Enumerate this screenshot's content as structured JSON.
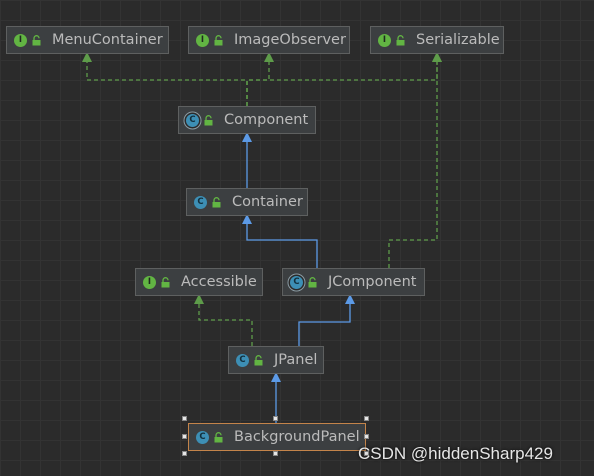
{
  "diagram": {
    "nodes": [
      {
        "id": "menucontainer",
        "label": "MenuContainer",
        "kind": "interface",
        "badge": "I"
      },
      {
        "id": "imageobserver",
        "label": "ImageObserver",
        "kind": "interface",
        "badge": "I"
      },
      {
        "id": "serializable",
        "label": "Serializable",
        "kind": "interface",
        "badge": "I"
      },
      {
        "id": "component",
        "label": "Component",
        "kind": "abstract-class",
        "badge": "C"
      },
      {
        "id": "container",
        "label": "Container",
        "kind": "class",
        "badge": "C"
      },
      {
        "id": "accessible",
        "label": "Accessible",
        "kind": "interface",
        "badge": "I"
      },
      {
        "id": "jcomponent",
        "label": "JComponent",
        "kind": "abstract-class",
        "badge": "C"
      },
      {
        "id": "jpanel",
        "label": "JPanel",
        "kind": "class",
        "badge": "C"
      },
      {
        "id": "backgroundpanel",
        "label": "BackgroundPanel",
        "kind": "class",
        "badge": "C",
        "selected": true
      }
    ],
    "edges": [
      {
        "from": "component",
        "to": "menucontainer",
        "type": "implements"
      },
      {
        "from": "component",
        "to": "imageobserver",
        "type": "implements"
      },
      {
        "from": "component",
        "to": "serializable",
        "type": "implements"
      },
      {
        "from": "container",
        "to": "component",
        "type": "extends"
      },
      {
        "from": "jcomponent",
        "to": "container",
        "type": "extends"
      },
      {
        "from": "jcomponent",
        "to": "serializable",
        "type": "implements"
      },
      {
        "from": "jpanel",
        "to": "jcomponent",
        "type": "extends"
      },
      {
        "from": "jpanel",
        "to": "accessible",
        "type": "implements"
      },
      {
        "from": "backgroundpanel",
        "to": "jpanel",
        "type": "extends"
      }
    ]
  },
  "colors": {
    "background": "#2b2b2b",
    "extends_edge": "#5c9ae6",
    "implements_edge": "#5e9c4a",
    "interface_badge": "#62b543",
    "class_badge": "#3d8fb5",
    "selection_border": "#c4844a"
  },
  "watermark": "CSDN @hiddenSharp429"
}
